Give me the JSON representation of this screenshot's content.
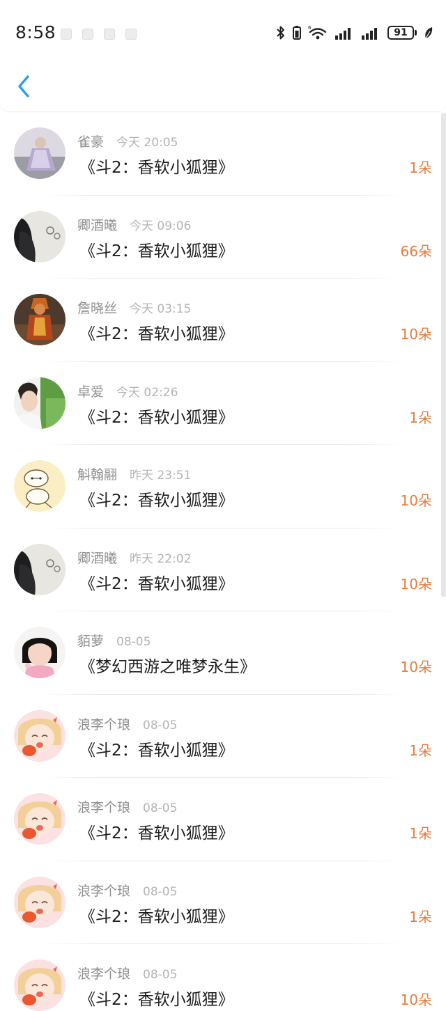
{
  "status_bar": {
    "time": "8:58",
    "battery_level": "91",
    "icons": [
      "bluetooth-icon",
      "phone-icon",
      "wifi-icon",
      "signal-icon",
      "signal-icon",
      "battery-icon",
      "leaf-icon"
    ]
  },
  "nav": {
    "back_icon": "chevron-left-icon",
    "accent_color": "#2c9cec"
  },
  "list": [
    {
      "name": "雀豪",
      "time": "今天 20:05",
      "title": "《斗2：香软小狐狸》",
      "amount": "1朵"
    },
    {
      "name": "卿酒曦",
      "time": "今天 09:06",
      "title": "《斗2：香软小狐狸》",
      "amount": "66朵"
    },
    {
      "name": "詹晓丝",
      "time": "今天 03:15",
      "title": "《斗2：香软小狐狸》",
      "amount": "10朵"
    },
    {
      "name": "卓爱",
      "time": "今天 02:26",
      "title": "《斗2：香软小狐狸》",
      "amount": "1朵"
    },
    {
      "name": "斛翰翮",
      "time": "昨天 23:51",
      "title": "《斗2：香软小狐狸》",
      "amount": "10朵"
    },
    {
      "name": "卿酒曦",
      "time": "昨天 22:02",
      "title": "《斗2：香软小狐狸》",
      "amount": "10朵"
    },
    {
      "name": "貊萝",
      "time": "08-05",
      "title": "《梦幻西游之唯梦永生》",
      "amount": "10朵"
    },
    {
      "name": "浪李个琅",
      "time": "08-05",
      "title": "《斗2：香软小狐狸》",
      "amount": "1朵"
    },
    {
      "name": "浪李个琅",
      "time": "08-05",
      "title": "《斗2：香软小狐狸》",
      "amount": "1朵"
    },
    {
      "name": "浪李个琅",
      "time": "08-05",
      "title": "《斗2：香软小狐狸》",
      "amount": "1朵"
    },
    {
      "name": "浪李个琅",
      "time": "08-05",
      "title": "《斗2：香软小狐狸》",
      "amount": "10朵"
    }
  ],
  "colors": {
    "amount": "#e87c3e",
    "name": "#8e8e8e",
    "time": "#b4b4b4",
    "title": "#1e1e1e"
  }
}
